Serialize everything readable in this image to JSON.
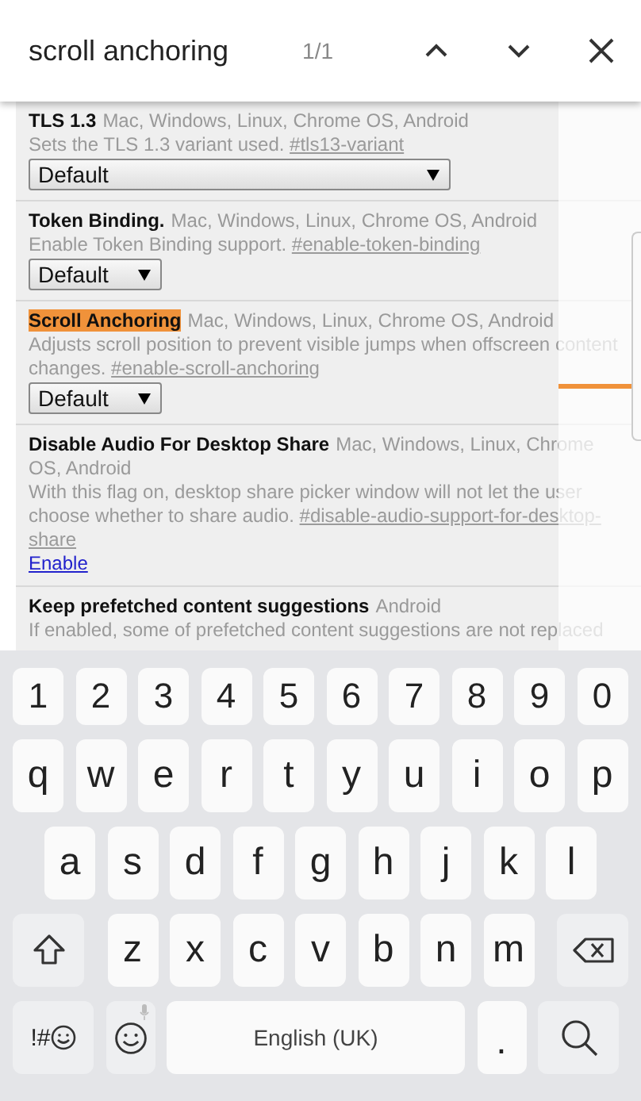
{
  "find_bar": {
    "query": "scroll anchoring",
    "count": "1/1"
  },
  "flags": [
    {
      "name": "TLS 1.3",
      "match": false,
      "platforms": "Mac, Windows, Linux, Chrome OS, Android",
      "description": "Sets the TLS 1.3 variant used.",
      "anchor": "#tls13-variant",
      "control": {
        "kind": "select",
        "value": "Default",
        "wide": true
      }
    },
    {
      "name": "Token Binding.",
      "match": false,
      "platforms": "Mac, Windows, Linux, Chrome OS, Android",
      "description": "Enable Token Binding support.",
      "anchor": "#enable-token-binding",
      "control": {
        "kind": "select",
        "value": "Default",
        "wide": false
      }
    },
    {
      "name": "Scroll Anchoring",
      "match": true,
      "platforms": "Mac, Windows, Linux, Chrome OS, Android",
      "description": "Adjusts scroll position to prevent visible jumps when offscreen content changes.",
      "anchor": "#enable-scroll-anchoring",
      "control": {
        "kind": "select",
        "value": "Default",
        "wide": false
      }
    },
    {
      "name": "Disable Audio For Desktop Share",
      "match": false,
      "platforms": "Mac, Windows, Linux, Chrome OS, Android",
      "description": "With this flag on, desktop share picker window will not let the user choose whether to share audio.",
      "anchor": "#disable-audio-support-for-desktop-share",
      "control": {
        "kind": "link",
        "value": "Enable"
      }
    },
    {
      "name": "Keep prefetched content suggestions",
      "match": false,
      "platforms": "Android",
      "description": "If enabled, some of prefetched content suggestions are not replaced"
    }
  ],
  "keyboard": {
    "rows": [
      {
        "keys": [
          {
            "kind": "char",
            "label": "1"
          },
          {
            "kind": "char",
            "label": "2"
          },
          {
            "kind": "char",
            "label": "3"
          },
          {
            "kind": "char",
            "label": "4"
          },
          {
            "kind": "char",
            "label": "5"
          },
          {
            "kind": "char",
            "label": "6"
          },
          {
            "kind": "char",
            "label": "7"
          },
          {
            "kind": "char",
            "label": "8"
          },
          {
            "kind": "char",
            "label": "9"
          },
          {
            "kind": "char",
            "label": "0"
          }
        ]
      },
      {
        "keys": [
          {
            "kind": "char",
            "label": "q"
          },
          {
            "kind": "char",
            "label": "w"
          },
          {
            "kind": "char",
            "label": "e"
          },
          {
            "kind": "char",
            "label": "r"
          },
          {
            "kind": "char",
            "label": "t"
          },
          {
            "kind": "char",
            "label": "y"
          },
          {
            "kind": "char",
            "label": "u"
          },
          {
            "kind": "char",
            "label": "i"
          },
          {
            "kind": "char",
            "label": "o"
          },
          {
            "kind": "char",
            "label": "p"
          }
        ]
      },
      {
        "keys": [
          {
            "kind": "char",
            "label": "a"
          },
          {
            "kind": "char",
            "label": "s"
          },
          {
            "kind": "char",
            "label": "d"
          },
          {
            "kind": "char",
            "label": "f"
          },
          {
            "kind": "char",
            "label": "g"
          },
          {
            "kind": "char",
            "label": "h"
          },
          {
            "kind": "char",
            "label": "j"
          },
          {
            "kind": "char",
            "label": "k"
          },
          {
            "kind": "char",
            "label": "l"
          }
        ]
      },
      {
        "keys": [
          {
            "kind": "shift"
          },
          {
            "kind": "char",
            "label": "z"
          },
          {
            "kind": "char",
            "label": "x"
          },
          {
            "kind": "char",
            "label": "c"
          },
          {
            "kind": "char",
            "label": "v"
          },
          {
            "kind": "char",
            "label": "b"
          },
          {
            "kind": "char",
            "label": "n"
          },
          {
            "kind": "char",
            "label": "m"
          },
          {
            "kind": "backspace"
          }
        ]
      },
      {
        "keys": [
          {
            "kind": "symbols",
            "label": "!#"
          },
          {
            "kind": "emoji"
          },
          {
            "kind": "space",
            "label": "English (UK)"
          },
          {
            "kind": "period",
            "label": "."
          },
          {
            "kind": "search"
          }
        ]
      }
    ]
  }
}
